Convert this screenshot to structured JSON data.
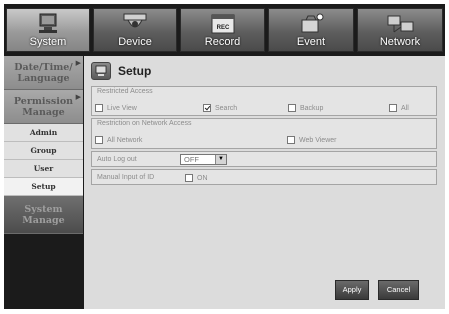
{
  "tabs": [
    {
      "label": "System",
      "icon": "system-icon"
    },
    {
      "label": "Device",
      "icon": "camera-icon"
    },
    {
      "label": "Record",
      "icon": "record-icon"
    },
    {
      "label": "Event",
      "icon": "event-icon"
    },
    {
      "label": "Network",
      "icon": "network-icon"
    }
  ],
  "sidebar": {
    "date_time_language": "Date/Time/ Language",
    "permission_manage": "Permission Manage",
    "sub_items": [
      "Admin",
      "Group",
      "User",
      "Setup"
    ],
    "system_manage": "System Manage"
  },
  "page": {
    "title": "Setup",
    "icon": "setup-icon"
  },
  "restricted_access": {
    "label": "Restricted Access",
    "options": [
      {
        "label": "Live View",
        "checked": false
      },
      {
        "label": "Search",
        "checked": true
      },
      {
        "label": "Backup",
        "checked": false
      },
      {
        "label": "All",
        "checked": false
      }
    ]
  },
  "network_access": {
    "label": "Restriction on Network Access",
    "options": [
      {
        "label": "All Network",
        "checked": false
      },
      {
        "label": "Web Viewer",
        "checked": false
      }
    ]
  },
  "auto_log_out": {
    "label": "Auto Log out",
    "value": "OFF"
  },
  "manual_input": {
    "label": "Manual Input of ID",
    "option_label": "ON",
    "checked": false
  },
  "buttons": {
    "apply": "Apply",
    "cancel": "Cancel"
  }
}
